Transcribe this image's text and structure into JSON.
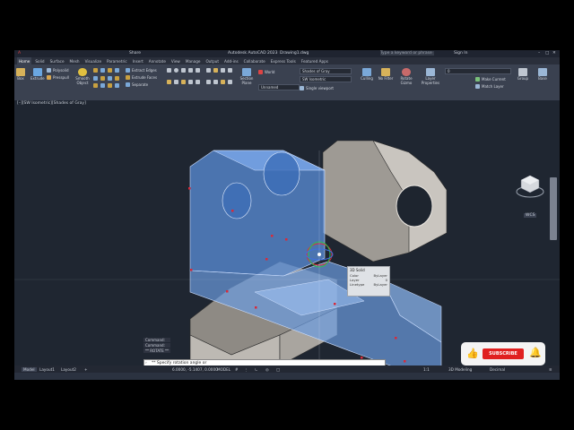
{
  "titlebar": {
    "app_title": "Autodesk AutoCAD 2023",
    "file_name": "Drawing1.dwg",
    "search_placeholder": "Type a keyword or phrase",
    "sign_in": "Sign In",
    "share": "Share"
  },
  "tabs": [
    "Home",
    "Solid",
    "Surface",
    "Mesh",
    "Visualize",
    "Parametric",
    "Insert",
    "Annotate",
    "View",
    "Manage",
    "Output",
    "Add-ins",
    "Collaborate",
    "Express Tools",
    "Featured Apps"
  ],
  "ribbon": {
    "box": "Box",
    "extrude": "Extrude",
    "polysolid": "Polysolid",
    "presspull": "Presspull",
    "smooth_object": "Smooth Object",
    "extract_edges": "Extract Edges",
    "extrude_faces": "Extrude Faces",
    "separate": "Separate",
    "section_plane": "Section Plane",
    "culling": "Culling",
    "no_filter": "No Filter",
    "rotate_gizmo": "Rotate Gizmo",
    "layer_properties": "Layer Properties",
    "make_current": "Make Current",
    "match_layer": "Match Layer",
    "group": "Group",
    "base": "Base",
    "visual_style": "Shades of Gray",
    "view_name": "SW Isometric",
    "ucs": "Unnamed",
    "viewport_config": "Single viewport",
    "world": "World",
    "layer_value": "0"
  },
  "panels": [
    "Modeling",
    "Mesh",
    "Solid Editing",
    "Draw",
    "Modify",
    "Section",
    "Coordinates",
    "View",
    "Selection",
    "Layers",
    "Groups",
    "View"
  ],
  "viewport": {
    "label": "[–][SW Isometric][Shades of Gray]",
    "viewcube_label": "WCS",
    "tooltip": {
      "title": "3D Solid",
      "rows": [
        {
          "k": "Color",
          "v": "ByLayer"
        },
        {
          "k": "Layer",
          "v": "0"
        },
        {
          "k": "Linetype",
          "v": "ByLayer"
        }
      ]
    }
  },
  "command": {
    "history": [
      "Command:",
      "Command:",
      "** ROTATE **"
    ],
    "prompt": "** Specify rotation angle or"
  },
  "status": {
    "model_tab": "Model",
    "layout1": "Layout1",
    "layout2": "Layout2",
    "add": "+",
    "coords": "6.0000, -5.1407, 0.0000",
    "model": "MODEL",
    "workspace": "3D Modeling",
    "units": "Decimal",
    "scale": "1:1"
  },
  "overlay": {
    "subscribe": "SUBSCRIBE",
    "colors": {
      "accent": "#e02020",
      "selection": "#5b8fd9",
      "gray_solid": "#bdb9b3"
    }
  }
}
